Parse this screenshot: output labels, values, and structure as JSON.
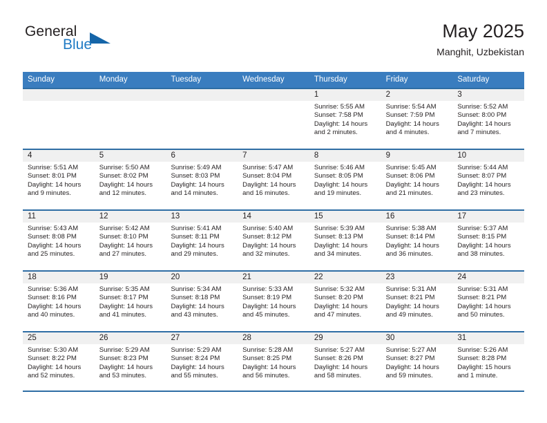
{
  "brand": {
    "name_top": "General",
    "name_bottom": "Blue",
    "triangle_color": "#1565a8",
    "blue_color": "#1f7ac4"
  },
  "header": {
    "title": "May 2025",
    "location": "Manghit, Uzbekistan"
  },
  "colors": {
    "header_bar": "#3a7dbf",
    "row_divider": "#2e6da4",
    "date_band": "#f0f0f0",
    "text": "#231f20"
  },
  "weekdays": [
    "Sunday",
    "Monday",
    "Tuesday",
    "Wednesday",
    "Thursday",
    "Friday",
    "Saturday"
  ],
  "weeks": [
    [
      {
        "day": "",
        "sunrise": "",
        "sunset": "",
        "daylight": "",
        "daylight2": ""
      },
      {
        "day": "",
        "sunrise": "",
        "sunset": "",
        "daylight": "",
        "daylight2": ""
      },
      {
        "day": "",
        "sunrise": "",
        "sunset": "",
        "daylight": "",
        "daylight2": ""
      },
      {
        "day": "",
        "sunrise": "",
        "sunset": "",
        "daylight": "",
        "daylight2": ""
      },
      {
        "day": "1",
        "sunrise": "Sunrise: 5:55 AM",
        "sunset": "Sunset: 7:58 PM",
        "daylight": "Daylight: 14 hours",
        "daylight2": "and 2 minutes."
      },
      {
        "day": "2",
        "sunrise": "Sunrise: 5:54 AM",
        "sunset": "Sunset: 7:59 PM",
        "daylight": "Daylight: 14 hours",
        "daylight2": "and 4 minutes."
      },
      {
        "day": "3",
        "sunrise": "Sunrise: 5:52 AM",
        "sunset": "Sunset: 8:00 PM",
        "daylight": "Daylight: 14 hours",
        "daylight2": "and 7 minutes."
      }
    ],
    [
      {
        "day": "4",
        "sunrise": "Sunrise: 5:51 AM",
        "sunset": "Sunset: 8:01 PM",
        "daylight": "Daylight: 14 hours",
        "daylight2": "and 9 minutes."
      },
      {
        "day": "5",
        "sunrise": "Sunrise: 5:50 AM",
        "sunset": "Sunset: 8:02 PM",
        "daylight": "Daylight: 14 hours",
        "daylight2": "and 12 minutes."
      },
      {
        "day": "6",
        "sunrise": "Sunrise: 5:49 AM",
        "sunset": "Sunset: 8:03 PM",
        "daylight": "Daylight: 14 hours",
        "daylight2": "and 14 minutes."
      },
      {
        "day": "7",
        "sunrise": "Sunrise: 5:47 AM",
        "sunset": "Sunset: 8:04 PM",
        "daylight": "Daylight: 14 hours",
        "daylight2": "and 16 minutes."
      },
      {
        "day": "8",
        "sunrise": "Sunrise: 5:46 AM",
        "sunset": "Sunset: 8:05 PM",
        "daylight": "Daylight: 14 hours",
        "daylight2": "and 19 minutes."
      },
      {
        "day": "9",
        "sunrise": "Sunrise: 5:45 AM",
        "sunset": "Sunset: 8:06 PM",
        "daylight": "Daylight: 14 hours",
        "daylight2": "and 21 minutes."
      },
      {
        "day": "10",
        "sunrise": "Sunrise: 5:44 AM",
        "sunset": "Sunset: 8:07 PM",
        "daylight": "Daylight: 14 hours",
        "daylight2": "and 23 minutes."
      }
    ],
    [
      {
        "day": "11",
        "sunrise": "Sunrise: 5:43 AM",
        "sunset": "Sunset: 8:08 PM",
        "daylight": "Daylight: 14 hours",
        "daylight2": "and 25 minutes."
      },
      {
        "day": "12",
        "sunrise": "Sunrise: 5:42 AM",
        "sunset": "Sunset: 8:10 PM",
        "daylight": "Daylight: 14 hours",
        "daylight2": "and 27 minutes."
      },
      {
        "day": "13",
        "sunrise": "Sunrise: 5:41 AM",
        "sunset": "Sunset: 8:11 PM",
        "daylight": "Daylight: 14 hours",
        "daylight2": "and 29 minutes."
      },
      {
        "day": "14",
        "sunrise": "Sunrise: 5:40 AM",
        "sunset": "Sunset: 8:12 PM",
        "daylight": "Daylight: 14 hours",
        "daylight2": "and 32 minutes."
      },
      {
        "day": "15",
        "sunrise": "Sunrise: 5:39 AM",
        "sunset": "Sunset: 8:13 PM",
        "daylight": "Daylight: 14 hours",
        "daylight2": "and 34 minutes."
      },
      {
        "day": "16",
        "sunrise": "Sunrise: 5:38 AM",
        "sunset": "Sunset: 8:14 PM",
        "daylight": "Daylight: 14 hours",
        "daylight2": "and 36 minutes."
      },
      {
        "day": "17",
        "sunrise": "Sunrise: 5:37 AM",
        "sunset": "Sunset: 8:15 PM",
        "daylight": "Daylight: 14 hours",
        "daylight2": "and 38 minutes."
      }
    ],
    [
      {
        "day": "18",
        "sunrise": "Sunrise: 5:36 AM",
        "sunset": "Sunset: 8:16 PM",
        "daylight": "Daylight: 14 hours",
        "daylight2": "and 40 minutes."
      },
      {
        "day": "19",
        "sunrise": "Sunrise: 5:35 AM",
        "sunset": "Sunset: 8:17 PM",
        "daylight": "Daylight: 14 hours",
        "daylight2": "and 41 minutes."
      },
      {
        "day": "20",
        "sunrise": "Sunrise: 5:34 AM",
        "sunset": "Sunset: 8:18 PM",
        "daylight": "Daylight: 14 hours",
        "daylight2": "and 43 minutes."
      },
      {
        "day": "21",
        "sunrise": "Sunrise: 5:33 AM",
        "sunset": "Sunset: 8:19 PM",
        "daylight": "Daylight: 14 hours",
        "daylight2": "and 45 minutes."
      },
      {
        "day": "22",
        "sunrise": "Sunrise: 5:32 AM",
        "sunset": "Sunset: 8:20 PM",
        "daylight": "Daylight: 14 hours",
        "daylight2": "and 47 minutes."
      },
      {
        "day": "23",
        "sunrise": "Sunrise: 5:31 AM",
        "sunset": "Sunset: 8:21 PM",
        "daylight": "Daylight: 14 hours",
        "daylight2": "and 49 minutes."
      },
      {
        "day": "24",
        "sunrise": "Sunrise: 5:31 AM",
        "sunset": "Sunset: 8:21 PM",
        "daylight": "Daylight: 14 hours",
        "daylight2": "and 50 minutes."
      }
    ],
    [
      {
        "day": "25",
        "sunrise": "Sunrise: 5:30 AM",
        "sunset": "Sunset: 8:22 PM",
        "daylight": "Daylight: 14 hours",
        "daylight2": "and 52 minutes."
      },
      {
        "day": "26",
        "sunrise": "Sunrise: 5:29 AM",
        "sunset": "Sunset: 8:23 PM",
        "daylight": "Daylight: 14 hours",
        "daylight2": "and 53 minutes."
      },
      {
        "day": "27",
        "sunrise": "Sunrise: 5:29 AM",
        "sunset": "Sunset: 8:24 PM",
        "daylight": "Daylight: 14 hours",
        "daylight2": "and 55 minutes."
      },
      {
        "day": "28",
        "sunrise": "Sunrise: 5:28 AM",
        "sunset": "Sunset: 8:25 PM",
        "daylight": "Daylight: 14 hours",
        "daylight2": "and 56 minutes."
      },
      {
        "day": "29",
        "sunrise": "Sunrise: 5:27 AM",
        "sunset": "Sunset: 8:26 PM",
        "daylight": "Daylight: 14 hours",
        "daylight2": "and 58 minutes."
      },
      {
        "day": "30",
        "sunrise": "Sunrise: 5:27 AM",
        "sunset": "Sunset: 8:27 PM",
        "daylight": "Daylight: 14 hours",
        "daylight2": "and 59 minutes."
      },
      {
        "day": "31",
        "sunrise": "Sunrise: 5:26 AM",
        "sunset": "Sunset: 8:28 PM",
        "daylight": "Daylight: 15 hours",
        "daylight2": "and 1 minute."
      }
    ]
  ]
}
